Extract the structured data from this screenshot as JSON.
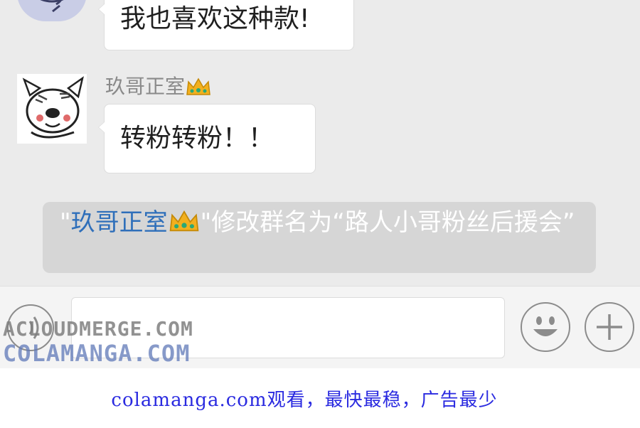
{
  "messages": [
    {
      "text": "我也喜欢这种款!"
    },
    {
      "sender": "玖哥正室",
      "sender_icon": "crown-icon",
      "text": "转粉转粉！！"
    }
  ],
  "system_notice": {
    "open_quote": "\"",
    "name": "玖哥正室",
    "name_icon": "crown-icon",
    "text": "\"修改群名为“路人小哥粉丝后援会”"
  },
  "input_bar": {
    "voice_icon": "voice-icon",
    "input_value": "",
    "emoji_icon": "smiley-icon",
    "plus_icon": "plus-icon"
  },
  "watermark": {
    "line1": "ACLOUDMERGE.COM",
    "line2": "COLAMANGA.COM"
  },
  "footer": {
    "text": "colamanga.com观看，最快最稳，广告最少"
  },
  "colors": {
    "chat_bg": "#ebebeb",
    "notice_bg": "#d6d6d6",
    "name_link": "#2f6fba",
    "footer_text": "#2a2ae0"
  }
}
